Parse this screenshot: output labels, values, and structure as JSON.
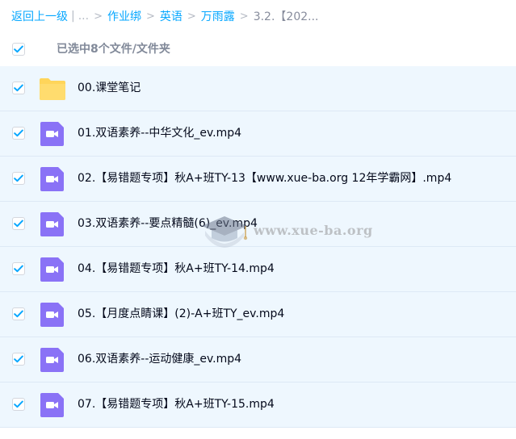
{
  "breadcrumb": {
    "back_label": "返回上一级",
    "ellipsis": "...",
    "items": [
      "作业绑",
      "英语",
      "万雨露"
    ],
    "current": "3.2.【202..."
  },
  "selection": {
    "summary": "已选中8个文件/文件夹",
    "all_checked": true
  },
  "files": [
    {
      "type": "folder",
      "name": "00.课堂笔记",
      "checked": true,
      "icon": "folder-icon"
    },
    {
      "type": "video",
      "name": "01.双语素养--中华文化_ev.mp4",
      "checked": true,
      "icon": "video-icon"
    },
    {
      "type": "video",
      "name": "02.【易错题专项】秋A+班TY-13【www.xue-ba.org 12年学霸网】.mp4",
      "checked": true,
      "icon": "video-icon"
    },
    {
      "type": "video",
      "name": "03.双语素养--要点精髓(6)_ev.mp4",
      "checked": true,
      "icon": "video-icon"
    },
    {
      "type": "video",
      "name": "04.【易错题专项】秋A+班TY-14.mp4",
      "checked": true,
      "icon": "video-icon"
    },
    {
      "type": "video",
      "name": "05.【月度点睛课】(2)-A+班TY_ev.mp4",
      "checked": true,
      "icon": "video-icon"
    },
    {
      "type": "video",
      "name": "06.双语素养--运动健康_ev.mp4",
      "checked": true,
      "icon": "video-icon"
    },
    {
      "type": "video",
      "name": "07.【易错题专项】秋A+班TY-15.mp4",
      "checked": true,
      "icon": "video-icon"
    }
  ],
  "watermark": {
    "text": "www.xue-ba.org",
    "icon": "graduation-cap-icon"
  },
  "colors": {
    "accent": "#06a7ff",
    "row_bg": "#eef7fe",
    "folder": "#ffd55a",
    "video": "#8a72f6"
  }
}
